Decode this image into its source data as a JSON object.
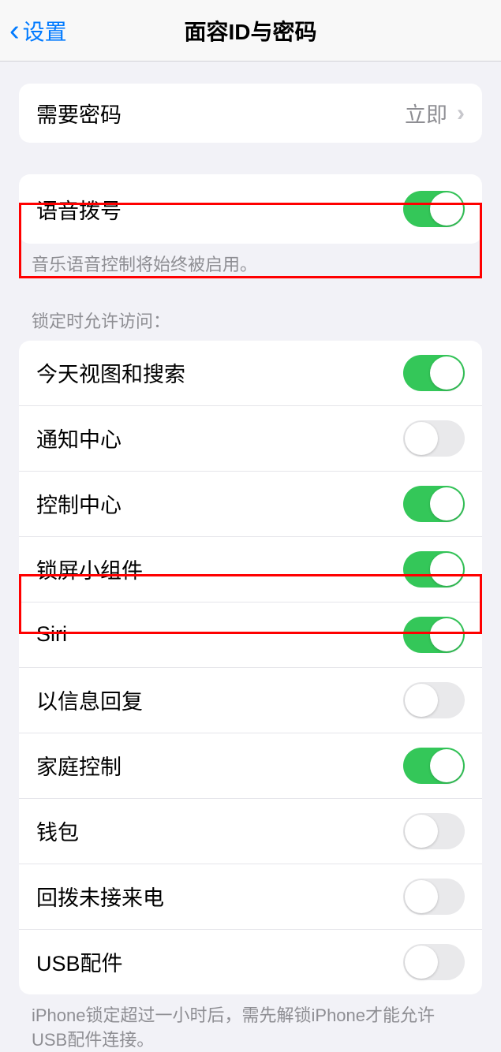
{
  "header": {
    "back_label": "设置",
    "title": "面容ID与密码"
  },
  "passcode_section": {
    "require_passcode_label": "需要密码",
    "require_passcode_value": "立即"
  },
  "voice_section": {
    "voice_dial_label": "语音拨号",
    "voice_dial_on": true,
    "footer": "音乐语音控制将始终被启用。"
  },
  "lock_access": {
    "header": "锁定时允许访问：",
    "items": [
      {
        "label": "今天视图和搜索",
        "on": true
      },
      {
        "label": "通知中心",
        "on": false
      },
      {
        "label": "控制中心",
        "on": true
      },
      {
        "label": "锁屏小组件",
        "on": true
      },
      {
        "label": "Siri",
        "on": true
      },
      {
        "label": "以信息回复",
        "on": false
      },
      {
        "label": "家庭控制",
        "on": true
      },
      {
        "label": "钱包",
        "on": false
      },
      {
        "label": "回拨未接来电",
        "on": false
      },
      {
        "label": "USB配件",
        "on": false
      }
    ],
    "footer": "iPhone锁定超过一小时后，需先解锁iPhone才能允许USB配件连接。"
  }
}
